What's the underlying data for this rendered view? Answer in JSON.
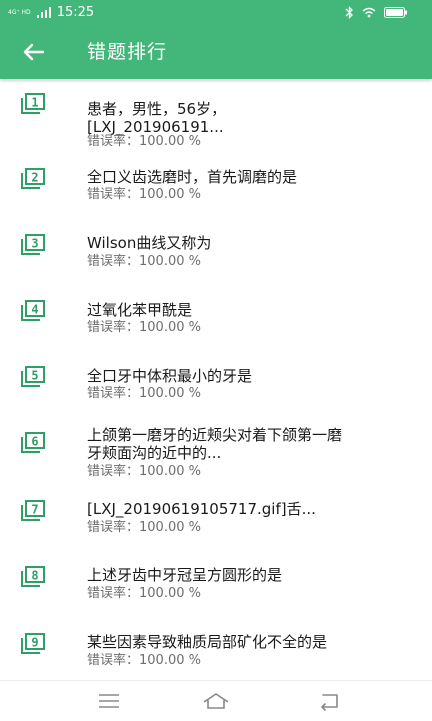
{
  "status_bar": {
    "network": "4G⁺ HD",
    "time": "15:25"
  },
  "app_bar": {
    "title": "错题排行"
  },
  "rate_prefix": "错误率：",
  "items": [
    {
      "number": "1",
      "lines": [
        "患者，男性，56岁，",
        "[LXJ_201906191..."
      ],
      "rate": "100.00 %"
    },
    {
      "number": "2",
      "lines": [
        "全口义齿选磨时，首先调磨的是"
      ],
      "rate": "100.00 %"
    },
    {
      "number": "3",
      "lines": [
        "Wilson曲线又称为"
      ],
      "rate": "100.00 %"
    },
    {
      "number": "4",
      "lines": [
        "过氧化苯甲酰是"
      ],
      "rate": "100.00 %"
    },
    {
      "number": "5",
      "lines": [
        "全口牙中体积最小的牙是"
      ],
      "rate": "100.00 %"
    },
    {
      "number": "6",
      "lines": [
        "上颌第一磨牙的近颊尖对着下颌第一磨",
        "牙颊面沟的近中的..."
      ],
      "rate": "100.00 %"
    },
    {
      "number": "7",
      "lines": [
        "[LXJ_20190619105717.gif]舌..."
      ],
      "rate": "100.00 %"
    },
    {
      "number": "8",
      "lines": [
        "上述牙齿中牙冠呈方圆形的是"
      ],
      "rate": "100.00 %"
    },
    {
      "number": "9",
      "lines": [
        "某些因素导致釉质局部矿化不全的是"
      ],
      "rate": "100.00 %"
    }
  ],
  "colors": {
    "primary": "#43b77a",
    "icon": "#2f9f68",
    "text": "#1a1a1a",
    "secondary_text": "#6e6e6e"
  },
  "icons": [
    "back-arrow-icon",
    "bluetooth-icon",
    "wifi-icon",
    "battery-icon",
    "menu-icon",
    "home-icon",
    "back-icon"
  ]
}
